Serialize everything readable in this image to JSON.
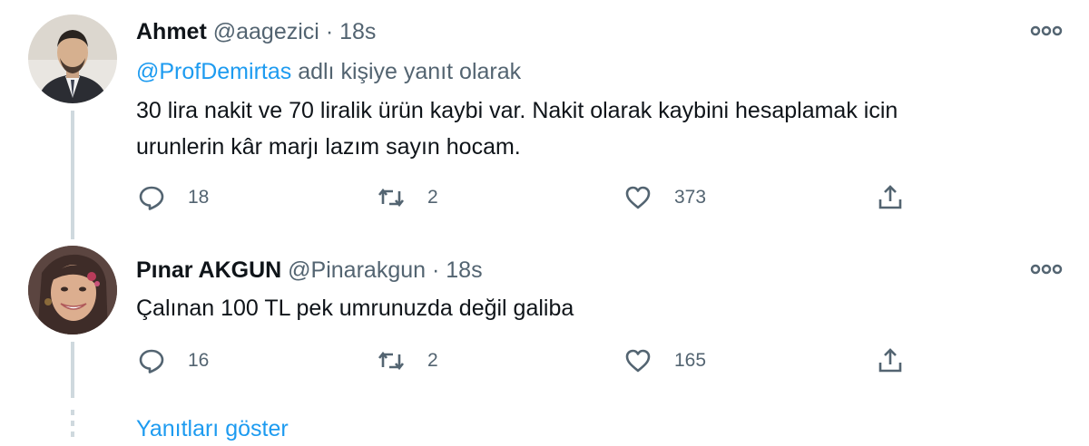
{
  "tweets": [
    {
      "name": "Ahmet",
      "handle": "@aagezici",
      "separator": "·",
      "time": "18s",
      "reply_mention": "@ProfDemirtas",
      "reply_suffix": " adlı kişiye yanıt olarak",
      "text_line1": "30 lira nakit ve 70 liralik ürün kaybi var. Nakit olarak kaybini hesaplamak icin",
      "text_line2": "urunlerin kâr marjı lazım sayın hocam.",
      "replies": "18",
      "retweets": "2",
      "likes": "373",
      "avatar_icon": "man-portrait-avatar"
    },
    {
      "name": "Pınar AKGUN",
      "handle": "@Pinarakgun",
      "separator": "·",
      "time": "18s",
      "text_line1": "Çalınan 100 TL pek umrunuzda değil galiba",
      "replies": "16",
      "retweets": "2",
      "likes": "165",
      "avatar_icon": "woman-portrait-avatar"
    }
  ],
  "show_replies_label": "Yanıtları göster",
  "icons": {
    "reply": "speech-bubble-icon",
    "retweet": "retweet-arrows-icon",
    "like": "heart-icon",
    "share": "share-upload-icon",
    "more": "three-dots-icon"
  },
  "colors": {
    "accent": "#1d9bf0",
    "secondary_text": "#536471",
    "primary_text": "#0f1419",
    "thread_line": "#cfd9de"
  }
}
